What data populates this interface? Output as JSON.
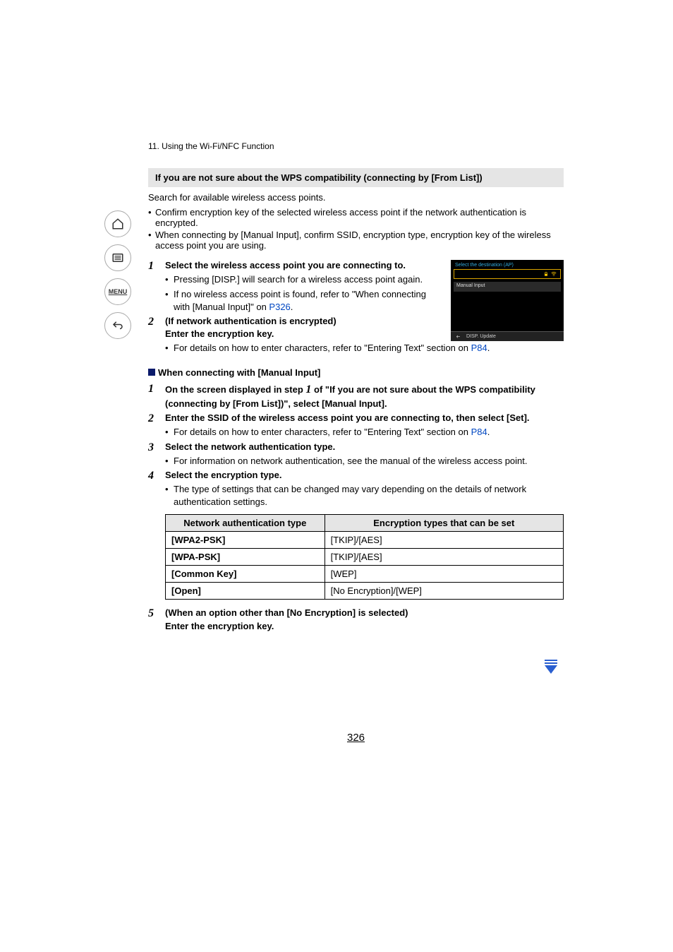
{
  "chapter": "11. Using the Wi-Fi/NFC Function",
  "heading": "If you are not sure about the WPS compatibility (connecting by [From List])",
  "intro": "Search for available wireless access points.",
  "bullets": [
    "Confirm encryption key of the selected wireless access point if the network authentication is encrypted.",
    "When connecting by [Manual Input], confirm SSID, encryption type, encryption key of the wireless access point you are using."
  ],
  "screenshot": {
    "title": "Select the destination (AP)",
    "manual": "Manual Input",
    "disp": "DISP. Update"
  },
  "steps_a": [
    {
      "num": "1",
      "bold": "Select the wireless access point you are connecting to.",
      "subs": [
        {
          "pre": "Pressing [DISP.] will search for a wireless access point again.",
          "link": ""
        },
        {
          "pre": "If no wireless access point is found, refer to \"When connecting with [Manual Input]\" on ",
          "link": "P326",
          "post": "."
        }
      ]
    },
    {
      "num": "2",
      "bold": "(If network authentication is encrypted)\nEnter the encryption key.",
      "subs": [
        {
          "pre": "For details on how to enter characters, refer to \"Entering Text\" section on ",
          "link": "P84",
          "post": "."
        }
      ]
    }
  ],
  "manual_section_title": "When connecting with [Manual Input]",
  "steps_b": [
    {
      "num": "1",
      "bold_parts": {
        "p1": "On the screen displayed in step ",
        "inline_num": "1",
        "p2": " of \"If you are not sure about the WPS compatibility (connecting by [From List])\", select [Manual Input]."
      }
    },
    {
      "num": "2",
      "bold": "Enter the SSID of the wireless access point you are connecting to, then select [Set].",
      "subs": [
        {
          "pre": "For details on how to enter characters, refer to \"Entering Text\" section on ",
          "link": "P84",
          "post": "."
        }
      ]
    },
    {
      "num": "3",
      "bold": "Select the network authentication type.",
      "subs": [
        {
          "pre": "For information on network authentication, see the manual of the wireless access point."
        }
      ]
    },
    {
      "num": "4",
      "bold": "Select the encryption type.",
      "subs": [
        {
          "pre": "The type of settings that can be changed may vary depending on the details of network authentication settings."
        }
      ]
    }
  ],
  "table": {
    "h1": "Network authentication type",
    "h2": "Encryption types that can be set",
    "rows": [
      {
        "c1": "[WPA2-PSK]",
        "c2": "[TKIP]/[AES]"
      },
      {
        "c1": "[WPA-PSK]",
        "c2": "[TKIP]/[AES]"
      },
      {
        "c1": "[Common Key]",
        "c2": "[WEP]"
      },
      {
        "c1": "[Open]",
        "c2": "[No Encryption]/[WEP]"
      }
    ]
  },
  "step5": {
    "num": "5",
    "line1": "(When an option other than [No Encryption] is selected)",
    "line2": "Enter the encryption key."
  },
  "page_number": "326",
  "sidebar_menu_label": "MENU"
}
